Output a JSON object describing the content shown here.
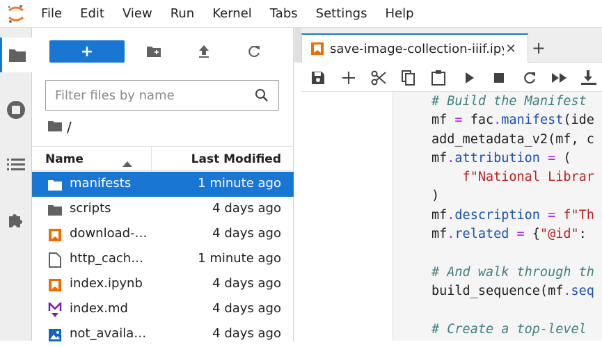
{
  "menubar": {
    "items": [
      "File",
      "Edit",
      "View",
      "Run",
      "Kernel",
      "Tabs",
      "Settings",
      "Help"
    ]
  },
  "activitybar": {
    "icons": [
      "folder-icon",
      "running-icon",
      "toc-icon",
      "extension-icon"
    ]
  },
  "filebrowser": {
    "new_label": "+",
    "filter_placeholder": "Filter files by name",
    "breadcrumb_sep": "/",
    "columns": {
      "name": "Name",
      "modified": "Last Modified"
    },
    "files": [
      {
        "name": "manifests",
        "modified": "1 minute ago",
        "icon": "folder-icon",
        "selected": true
      },
      {
        "name": "scripts",
        "modified": "4 days ago",
        "icon": "folder-icon",
        "selected": false
      },
      {
        "name": "download-…",
        "modified": "4 days ago",
        "icon": "notebook-icon",
        "selected": false
      },
      {
        "name": "http_cach…",
        "modified": "1 minute ago",
        "icon": "file-icon",
        "selected": false
      },
      {
        "name": "index.ipynb",
        "modified": "4 days ago",
        "icon": "notebook-icon",
        "selected": false
      },
      {
        "name": "index.md",
        "modified": "4 days ago",
        "icon": "markdown-icon",
        "selected": false
      },
      {
        "name": "not_availa…",
        "modified": "4 days ago",
        "icon": "image-icon",
        "selected": false
      }
    ]
  },
  "main": {
    "tab": {
      "label": "save-image-collection-iiif.ipy",
      "close": "✕"
    },
    "add_tab": "+",
    "code_lines": [
      [
        {
          "t": "# Build the Manifest",
          "c": "c-comment"
        }
      ],
      [
        {
          "t": "mf ",
          "c": "c-var"
        },
        {
          "t": "=",
          "c": "c-op"
        },
        {
          "t": " fac",
          "c": "c-var"
        },
        {
          "t": ".",
          "c": "c-op"
        },
        {
          "t": "manifest",
          "c": "c-attr"
        },
        {
          "t": "(ide",
          "c": "c-var"
        }
      ],
      [
        {
          "t": "add_metadata_v2(mf, c",
          "c": "c-var"
        }
      ],
      [
        {
          "t": "mf",
          "c": "c-var"
        },
        {
          "t": ".",
          "c": "c-op"
        },
        {
          "t": "attribution",
          "c": "c-attr"
        },
        {
          "t": " ",
          "c": "c-var"
        },
        {
          "t": "=",
          "c": "c-op"
        },
        {
          "t": " (",
          "c": "c-var"
        }
      ],
      [
        {
          "t": "    f\"National Librar",
          "c": "c-str"
        }
      ],
      [
        {
          "t": ")",
          "c": "c-var"
        }
      ],
      [
        {
          "t": "mf",
          "c": "c-var"
        },
        {
          "t": ".",
          "c": "c-op"
        },
        {
          "t": "description",
          "c": "c-attr"
        },
        {
          "t": " ",
          "c": "c-var"
        },
        {
          "t": "=",
          "c": "c-op"
        },
        {
          "t": " f\"Th",
          "c": "c-str"
        }
      ],
      [
        {
          "t": "mf",
          "c": "c-var"
        },
        {
          "t": ".",
          "c": "c-op"
        },
        {
          "t": "related",
          "c": "c-attr"
        },
        {
          "t": " ",
          "c": "c-var"
        },
        {
          "t": "=",
          "c": "c-op"
        },
        {
          "t": " {",
          "c": "c-var"
        },
        {
          "t": "\"@id\"",
          "c": "c-str"
        },
        {
          "t": ":",
          "c": "c-var"
        }
      ],
      [
        {
          "t": "",
          "c": "c-var"
        }
      ],
      [
        {
          "t": "# And walk through th",
          "c": "c-comment"
        }
      ],
      [
        {
          "t": "build_sequence(mf",
          "c": "c-var"
        },
        {
          "t": ".",
          "c": "c-op"
        },
        {
          "t": "seq",
          "c": "c-attr"
        }
      ],
      [
        {
          "t": "",
          "c": "c-var"
        }
      ],
      [
        {
          "t": "# Create a top-level ",
          "c": "c-comment"
        }
      ]
    ]
  },
  "colors": {
    "accent": "#1976d2",
    "logo": "#f37726",
    "notebook_icon": "#ef6c00",
    "markdown_icon": "#7b1fa2",
    "image_icon": "#1565c0"
  }
}
